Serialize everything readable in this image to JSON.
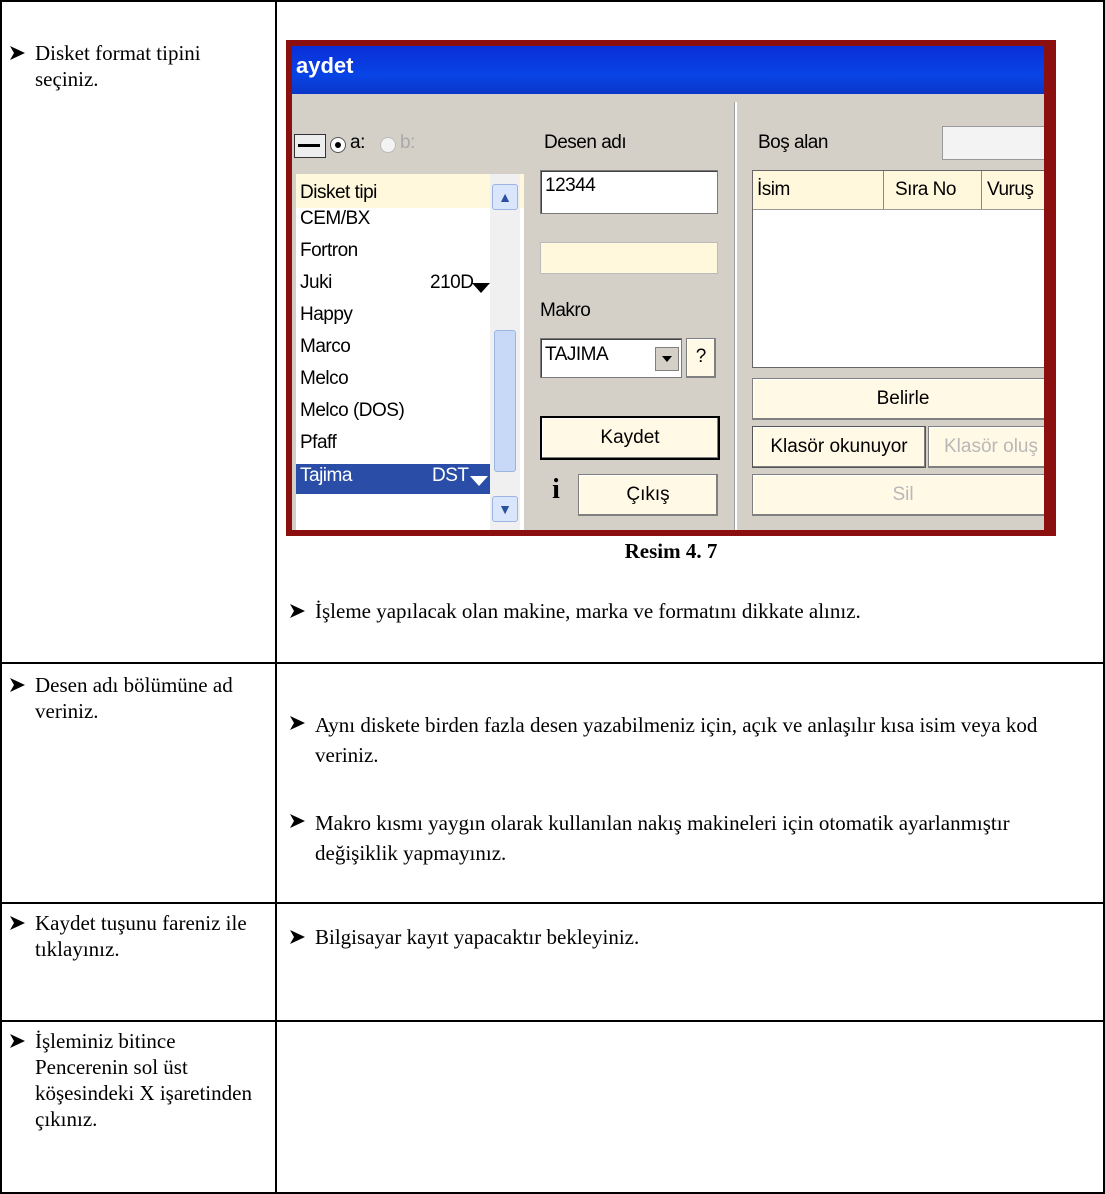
{
  "rows": [
    {
      "left": [
        "Disket format tipini seçiniz."
      ],
      "figure_caption": "Resim 4. 7",
      "right": [
        "İşleme yapılacak olan makine, marka ve formatını dikkate alınız."
      ]
    },
    {
      "left": [
        "Desen adı bölümüne ad veriniz."
      ],
      "right": [
        "Aynı diskete birden fazla desen yazabilmeniz için, açık ve anlaşılır kısa isim veya kod veriniz.",
        "Makro kısmı yaygın olarak kullanılan nakış makineleri için otomatik ayarlanmıştır değişiklik yapmayınız."
      ]
    },
    {
      "left": [
        "Kaydet tuşunu fareniz ile tıklayınız."
      ],
      "right": [
        "Bilgisayar kayıt yapacaktır bekleyiniz."
      ]
    },
    {
      "left": [
        "İşleminiz bitince Pencerenin sol üst köşesindeki X işaretinden çıkınız."
      ],
      "right": []
    }
  ],
  "dialog": {
    "title": "aydet",
    "drive_a": "a:",
    "drive_b": "b:",
    "list_header": "Disket tipi",
    "list_items": [
      "CEM/BX",
      "Fortron",
      "Juki",
      "Happy",
      "Marco",
      "Melco",
      "Melco (DOS)",
      "Pfaff",
      "Tajima"
    ],
    "juki_format": "210D",
    "tajima_format": "DST",
    "selected_item": "Tajima",
    "desen_label": "Desen adı",
    "desen_value": "12344",
    "makro_label": "Makro",
    "makro_value": "TAJIMA",
    "help_button": "?",
    "kaydet_button": "Kaydet",
    "cikis_button": "Çıkış",
    "info_icon_glyph": "i",
    "bos_alan_label": "Boş alan",
    "columns": [
      "İsim",
      "Sıra No",
      "Vuruş"
    ],
    "belirle_button": "Belirle",
    "klasor_okunuyor_button": "Klasör okunuyor",
    "klasor_olustur_button": "Klasör oluş",
    "sil_button": "Sil"
  }
}
